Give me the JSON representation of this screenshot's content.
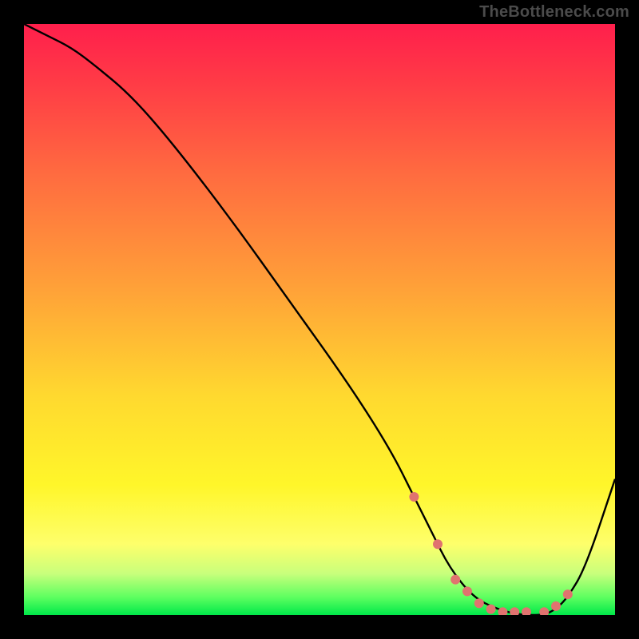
{
  "watermark": "TheBottleneck.com",
  "chart_data": {
    "type": "line",
    "title": "",
    "xlabel": "",
    "ylabel": "",
    "xlim": [
      0,
      100
    ],
    "ylim": [
      0,
      100
    ],
    "series": [
      {
        "name": "bottleneck-curve",
        "x": [
          0,
          4,
          8,
          12,
          18,
          25,
          35,
          45,
          55,
          62,
          66,
          69,
          72,
          76,
          80,
          84,
          88,
          90,
          92,
          95,
          100
        ],
        "y": [
          100,
          98,
          96,
          93,
          88,
          80,
          67,
          53,
          39,
          28,
          20,
          14,
          8,
          3,
          1,
          0,
          0,
          1,
          3,
          8,
          23
        ]
      }
    ],
    "markers": {
      "name": "highlight-dots",
      "color": "#e0736f",
      "x": [
        66,
        70,
        73,
        75,
        77,
        79,
        81,
        83,
        85,
        88,
        90,
        92
      ],
      "y": [
        20,
        12,
        6,
        4,
        2,
        1,
        0.5,
        0.5,
        0.5,
        0.5,
        1.5,
        3.5
      ]
    },
    "gradient_colors": {
      "top": "#ff1f4c",
      "mid_upper": "#ff6a40",
      "mid": "#ffd92f",
      "mid_lower": "#feff6b",
      "bottom": "#00e84a"
    }
  }
}
